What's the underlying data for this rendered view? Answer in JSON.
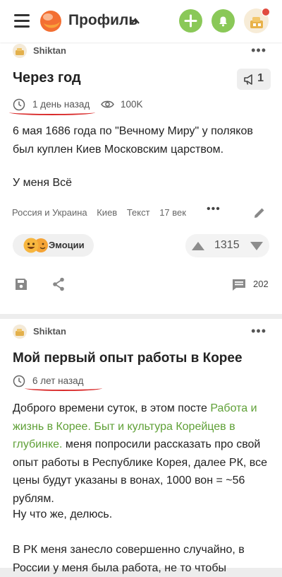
{
  "header": {
    "title": "Профиль",
    "colors": {
      "accent_green": "#8ac858",
      "notification_dot": "#e14b3f"
    },
    "icons": [
      "menu-icon",
      "logo-icon",
      "chevron-up-icon",
      "plus-icon",
      "bell-icon",
      "user-avatar"
    ]
  },
  "post1": {
    "author": "Shiktan",
    "title": "Через год",
    "badge_count": "1",
    "time": "1 день назад",
    "views": "100K",
    "body_line1": "6 мая 1686 года по \"Вечному Миру\" у поляков был куплен Киев Московским царством.",
    "body_line2": "У меня Всё",
    "tags": [
      "Россия и Украина",
      "Киев",
      "Текст",
      "17 век"
    ],
    "emotions_label": "Эмоции",
    "rating": "1315",
    "comments": "202"
  },
  "post2": {
    "author": "Shiktan",
    "title": "Мой первый опыт работы в Корее",
    "time": "6 лет назад",
    "body_pre": "Доброго времени суток, в этом посте ",
    "body_link": "Работа и жизнь в Корее. Быт и культура Корейцев в глубинке.",
    "body_post": " меня попросили рассказать про свой опыт работы в Республике Корея, далее РК, все цены будут указаны в вонах, 1000 вон = ~56 рублям.",
    "body_line2": "Ну что же, делюсь.",
    "body_line3": "В РК меня занесло совершенно случайно, в России у меня была работа, не то чтобы"
  },
  "annotations": {
    "underline_color": "#d92b2b"
  }
}
